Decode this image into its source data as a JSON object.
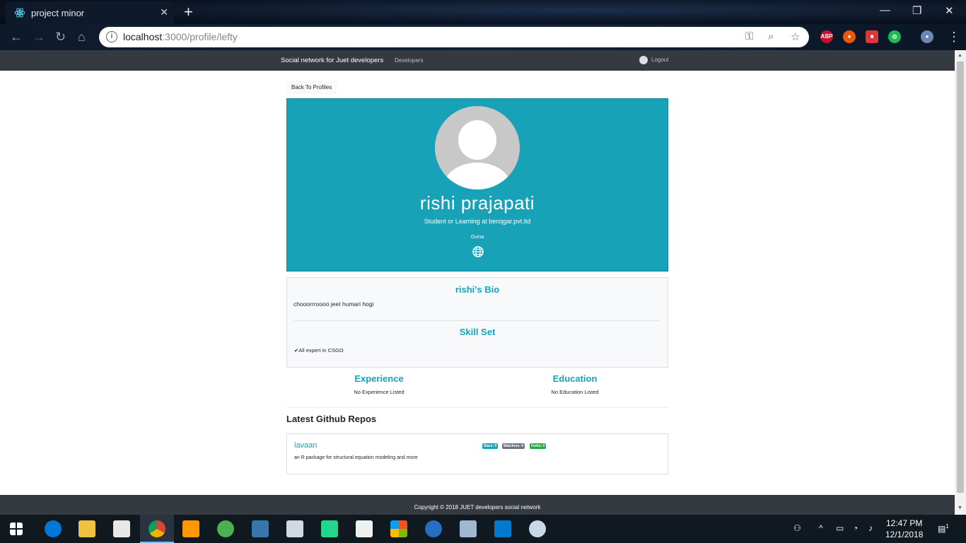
{
  "browser": {
    "tab_title": "project minor",
    "tab_close": "✕",
    "new_tab": "+",
    "url_host": "localhost",
    "url_rest": ":3000/profile/lefty"
  },
  "navbar": {
    "brand": "Social network for Juet developers",
    "developers_link": "Developers",
    "logout_link": "Logout"
  },
  "profile": {
    "back_button": "Back To Profiles",
    "name": "rishi prajapati",
    "status": "Student or Learning at berojgar.pvt.ltd",
    "location": "Guna",
    "bio_heading": "rishi's Bio",
    "bio_text": "chooorrroooo jeet humari hogi",
    "skills_heading": "Skill Set",
    "skills": [
      "All expert in CSGO"
    ],
    "experience_heading": "Experience",
    "experience_empty": "No Experience Listed",
    "education_heading": "Education",
    "education_empty": "No Education Listed"
  },
  "repos": {
    "heading": "Latest Github Repos",
    "items": [
      {
        "name": "lavaan",
        "description": "an R package for structural equation modeling and more",
        "stars": "Stars: 0",
        "watchers": "Watchers: 0",
        "forks": "Forks: 0"
      }
    ]
  },
  "footer": {
    "copyright": "Copyright © 2018 JUET developers social network"
  },
  "taskbar": {
    "time": "12:47 PM",
    "date": "12/1/2018",
    "notification_count": "1"
  },
  "colors": {
    "accent": "#17a2b8",
    "navbar": "#343a40",
    "badge_primary": "#17a2b8",
    "badge_secondary": "#6c757d",
    "badge_success": "#28a745"
  }
}
